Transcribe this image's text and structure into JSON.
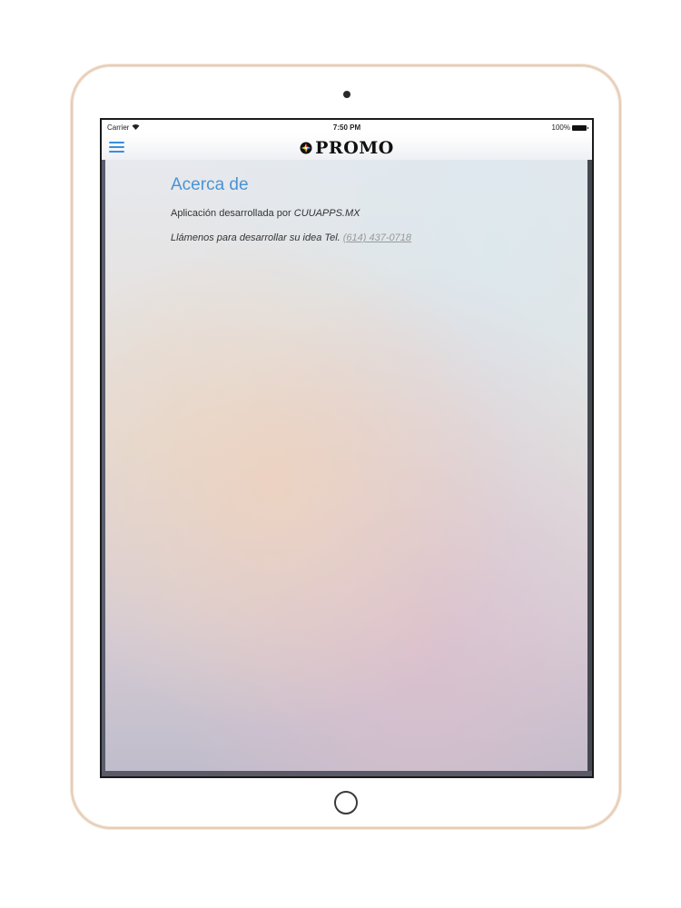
{
  "status_bar": {
    "carrier": "Carrier",
    "time": "7:50 PM",
    "battery": "100%"
  },
  "nav": {
    "logo_text": "PROMO",
    "menu_icon": "hamburger-menu-icon"
  },
  "about": {
    "title": "Acerca de",
    "developed_by_prefix": "Aplicación desarrollada por ",
    "company": "CUUAPPS.MX",
    "call_prefix": "Llámenos para desarrollar su idea Tel. ",
    "phone": "(614) 437-0718"
  },
  "colors": {
    "accent": "#4a93d4",
    "link": "#999999",
    "device_frame": "#e6cdb6"
  }
}
